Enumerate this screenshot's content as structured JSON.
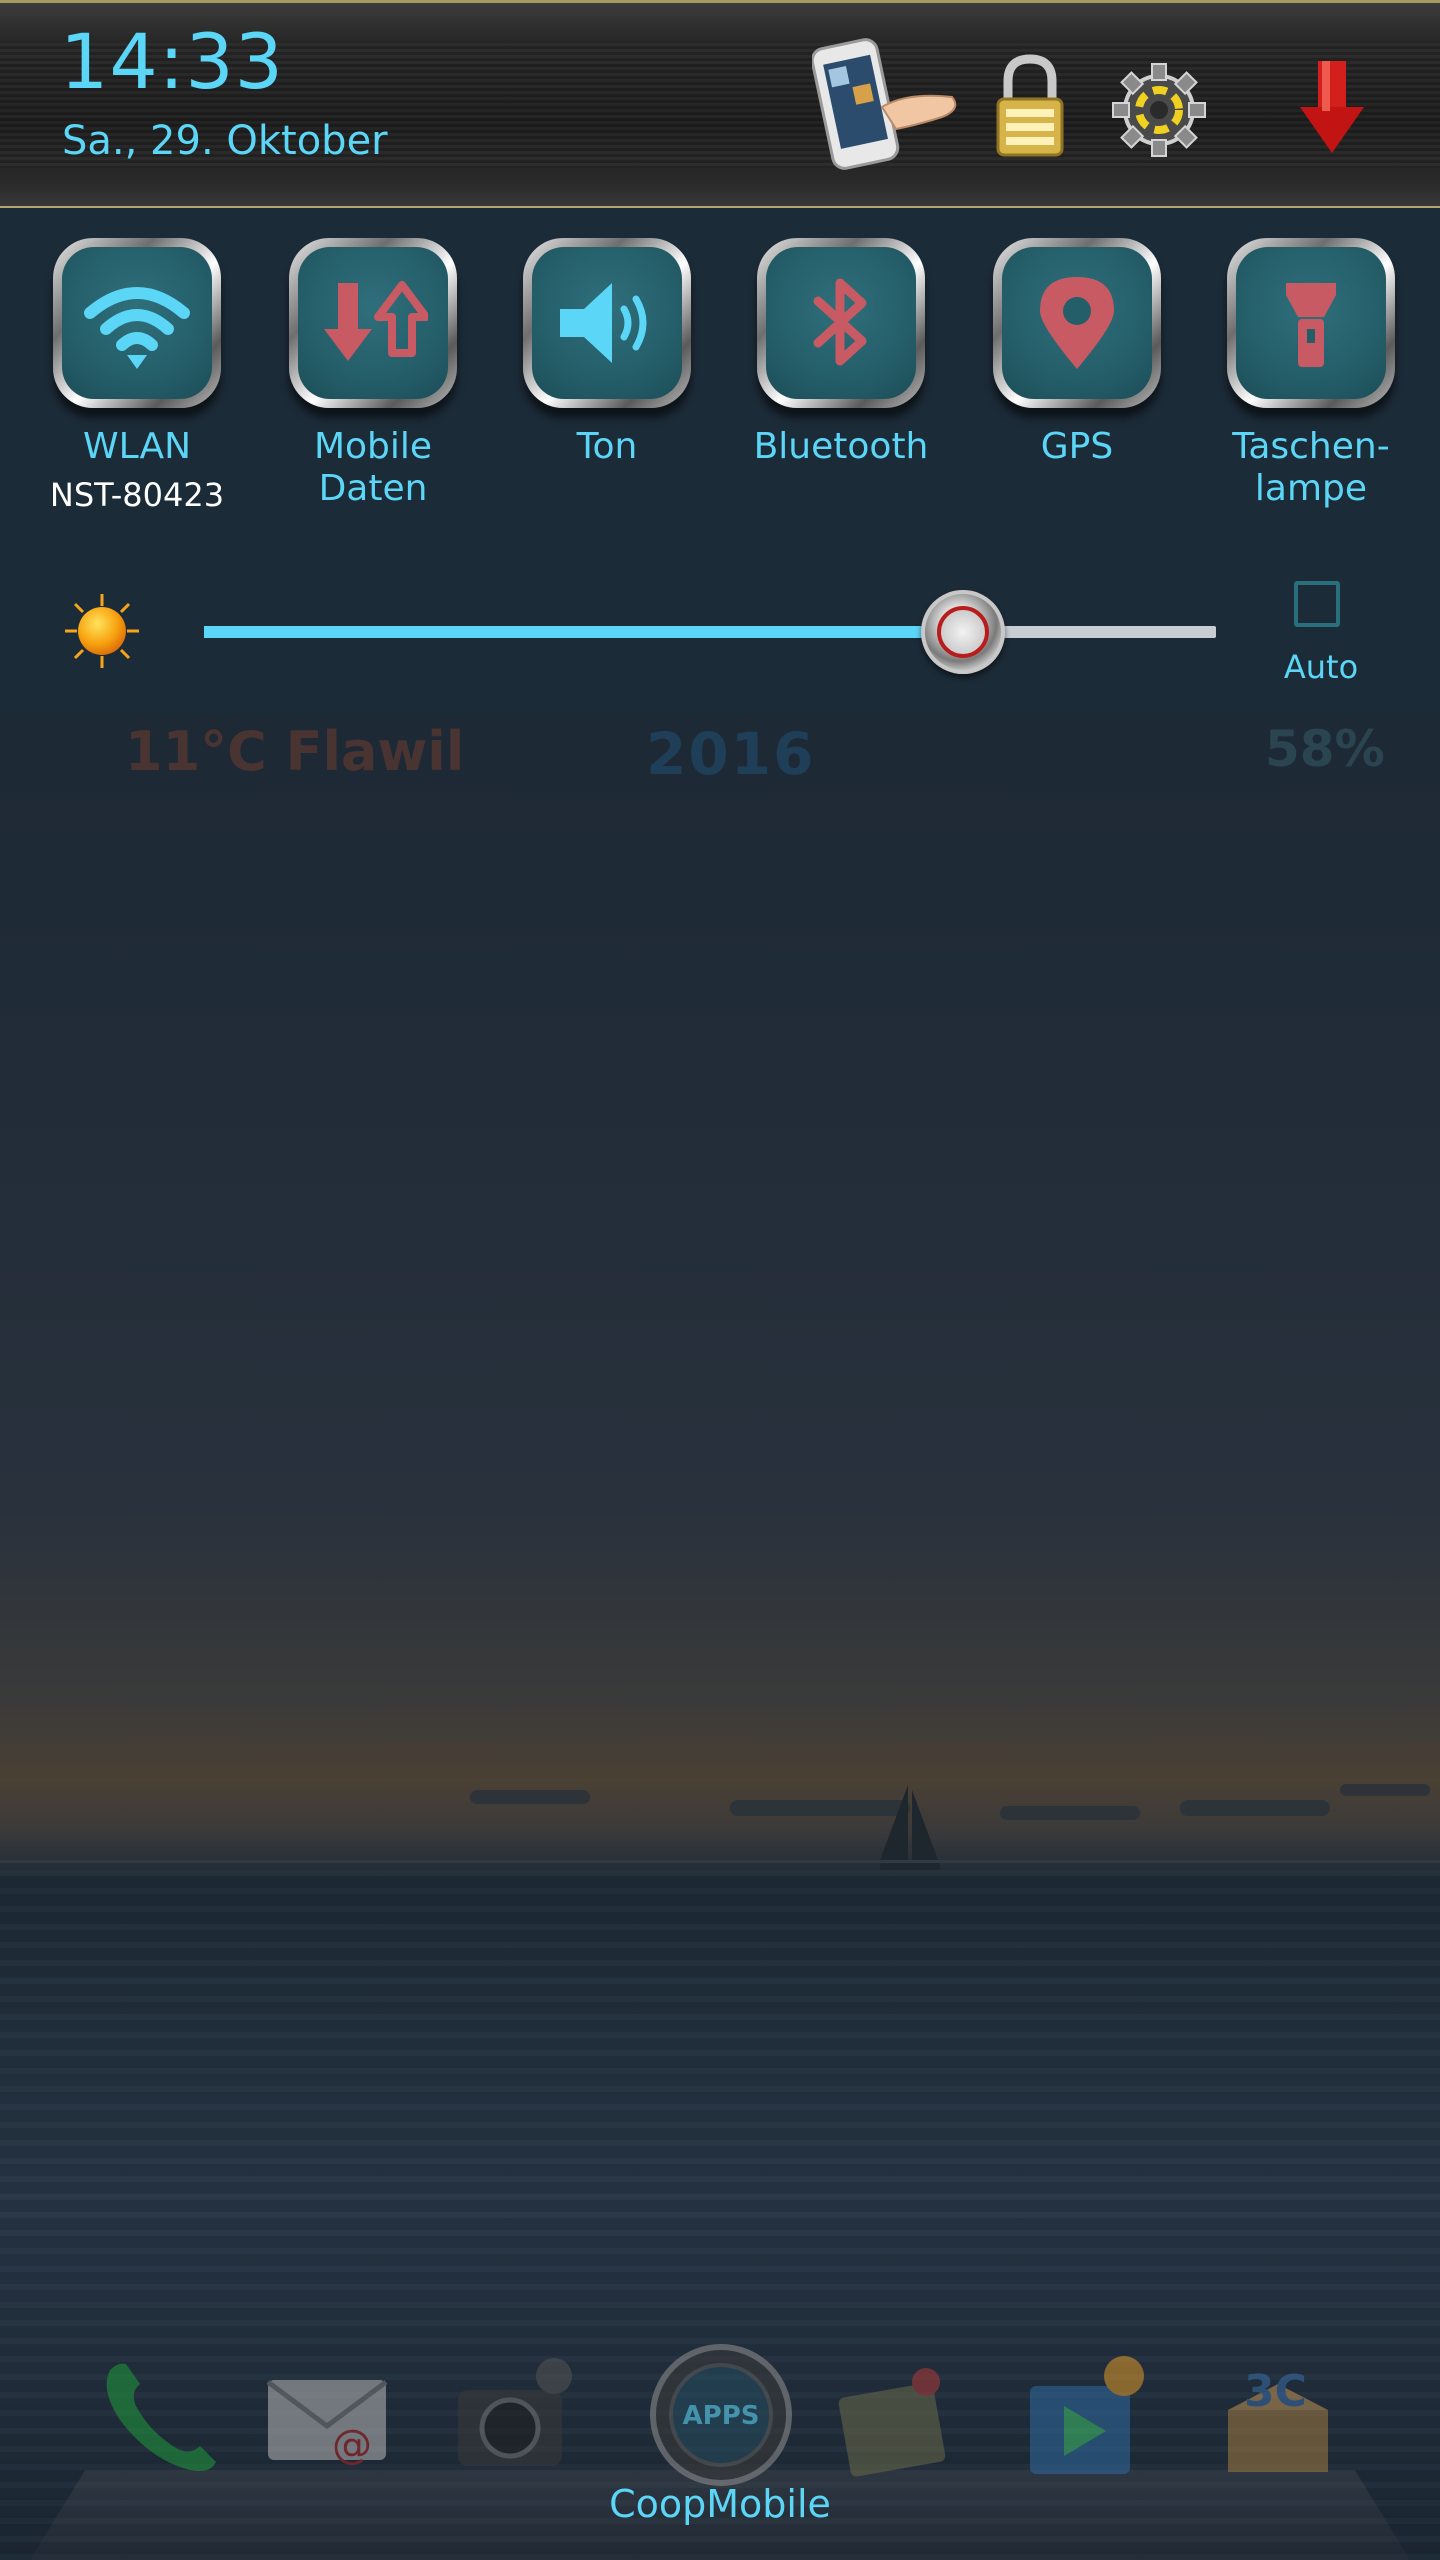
{
  "status": {
    "time": "14:33",
    "date": "Sa., 29. Oktober"
  },
  "header_icons": [
    {
      "name": "screenshot-icon"
    },
    {
      "name": "lock-icon"
    },
    {
      "name": "settings-gear-icon"
    },
    {
      "name": "collapse-arrow-icon"
    }
  ],
  "tiles": [
    {
      "label": "WLAN",
      "sub": "NST-80423",
      "icon": "wifi-icon",
      "active": true
    },
    {
      "label": "Mobile\nDaten",
      "icon": "mobile-data-icon",
      "active": false
    },
    {
      "label": "Ton",
      "icon": "sound-icon",
      "active": true
    },
    {
      "label": "Bluetooth",
      "icon": "bluetooth-icon",
      "active": false
    },
    {
      "label": "GPS",
      "icon": "gps-icon",
      "active": false
    },
    {
      "label": "Taschen-\nlampe",
      "icon": "flashlight-icon",
      "active": false
    }
  ],
  "brightness": {
    "level": 0.75,
    "auto_label": "Auto",
    "auto_checked": false
  },
  "widgets": {
    "weather": "11°C Flawil",
    "year": "2016",
    "battery": "58%"
  },
  "dock": {
    "label": "CoopMobile",
    "items": [
      "phone-icon",
      "email-icon",
      "camera-icon",
      "apps-drawer-icon",
      "gallery-icon",
      "play-store-icon",
      "app-box-icon"
    ]
  },
  "colors": {
    "accent": "#5cd6f7",
    "inactive_icon": "#c85a64",
    "tile_face": "#245e69"
  }
}
